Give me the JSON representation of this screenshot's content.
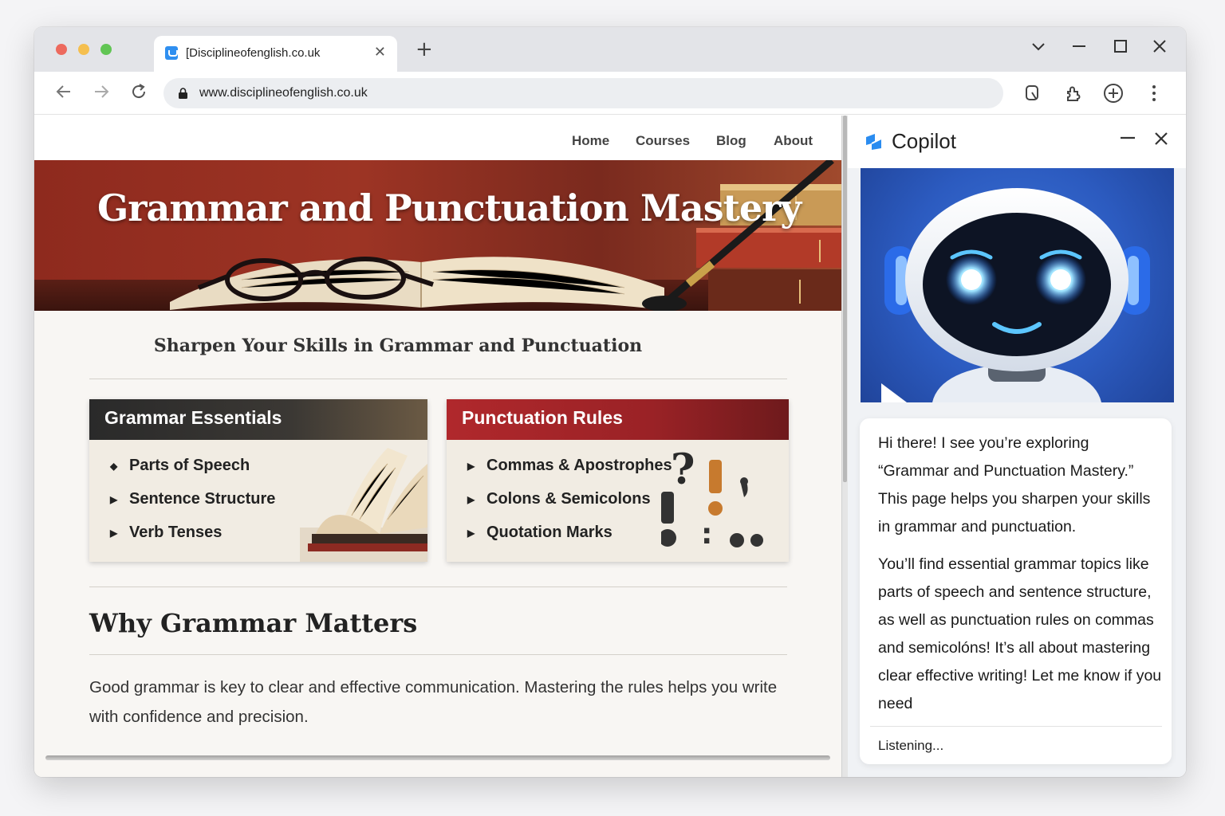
{
  "browser": {
    "tab_title": "[Disciplineofenglish.co.uk",
    "url": "www.disciplineofenglish.co.uk",
    "tab_close_icon": "close-icon",
    "new_tab_icon": "plus-icon"
  },
  "site": {
    "nav": [
      "Home",
      "Courses",
      "Blog",
      "About"
    ],
    "hero_title": "Grammar and Punctuation Mastery",
    "subtitle": "Sharpen Your Skills in Grammar and Punctuation",
    "cards": [
      {
        "title": "Grammar Essentials",
        "items": [
          "Parts of Speech",
          "Sentence Structure",
          "Verb Tenses"
        ]
      },
      {
        "title": "Punctuation Rules",
        "items": [
          "Commas & Apostrophes",
          "Colons & Semicolons",
          "Quotation Marks"
        ]
      }
    ],
    "section_title": "Why Grammar Matters",
    "section_body": "Good grammar is key to clear and effective communication. Mastering the rules helps you write with confidence and precision."
  },
  "copilot": {
    "title": "Copilot",
    "message_p1": "Hi there! I see you’re exploring “Grammar and Punctuation Mastery.” This page helps you sharpen your skills in grammar and punctuation.",
    "message_p2": "You’ll find essential grammar topics like parts of speech and sentence structure, as well as punctuation rules on commas and semicolóns! It’s all about mastering clear effective writing! Let me know if you need",
    "status": "Listening..."
  },
  "colors": {
    "hero_red": "#9d3424",
    "punct_header_red": "#b0282c",
    "grammar_header_dark": "#2a2a2a",
    "copilot_blue": "#2c5bc0"
  }
}
